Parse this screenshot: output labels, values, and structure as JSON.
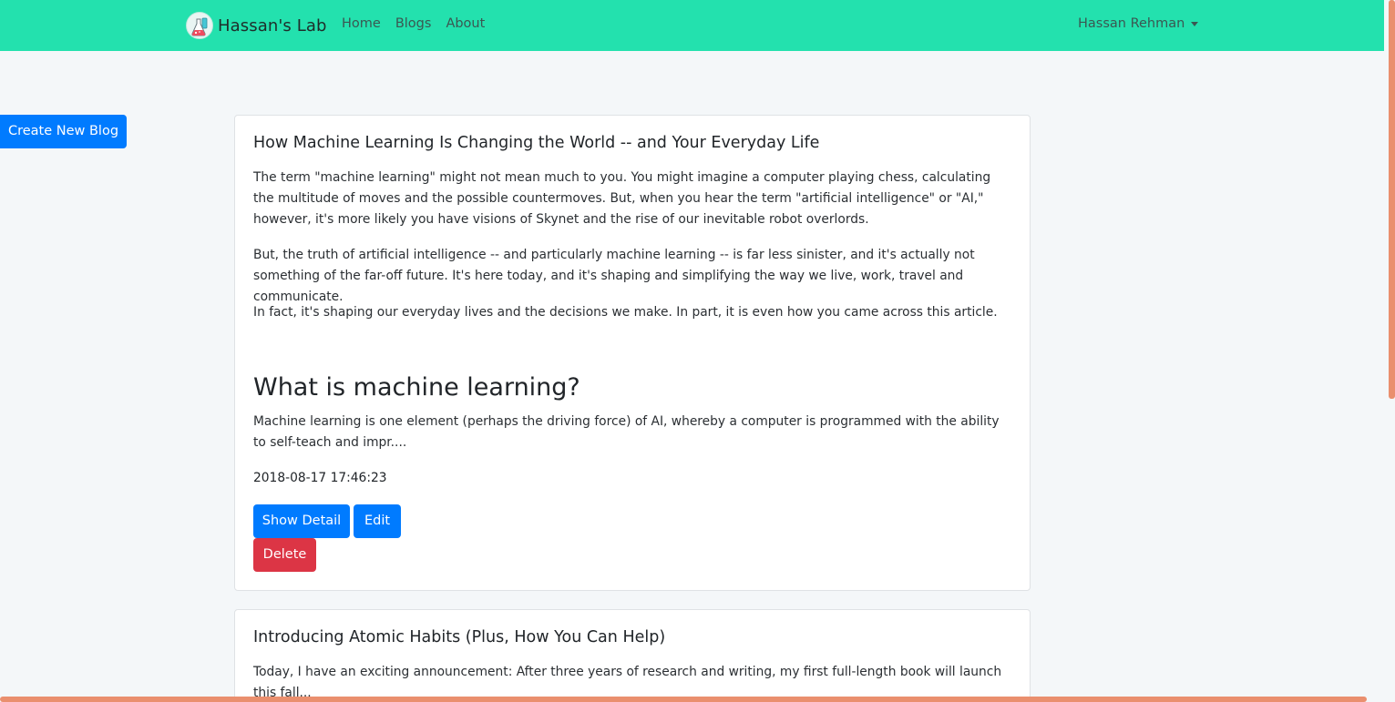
{
  "navbar": {
    "brand": "Hassan's Lab",
    "links": [
      "Home",
      "Blogs",
      "About"
    ],
    "user": "Hassan Rehman"
  },
  "actions": {
    "create_label": "Create New Blog"
  },
  "posts": [
    {
      "title": "How Machine Learning Is Changing the World -- and Your Everyday Life",
      "paragraphs": [
        "The term \"machine learning\" might not mean much to you. You might imagine a computer playing chess, calculating the multitude of moves and the possible countermoves. But, when you hear the term \"artificial intelligence\" or \"AI,\" however, it's more likely you have visions of Skynet and the rise of our inevitable robot overlords.",
        "But, the truth of artificial intelligence -- and particularly machine learning -- is far less sinister, and it's actually not something of the far-off future. It's here today, and it's shaping and simplifying the way we live, work, travel and communicate.",
        "In fact, it's shaping our everyday lives and the decisions we make. In part, it is even how you came across this article."
      ],
      "subheading": "What is machine learning?",
      "excerpt": "Machine learning is one element (perhaps the driving force) of AI, whereby a computer is programmed with the ability to self-teach and impr....",
      "date": "2018-08-17 17:46:23",
      "buttons": {
        "show": "Show Detail",
        "edit": "Edit",
        "delete": "Delete"
      }
    },
    {
      "title": "Introducing Atomic Habits (Plus, How You Can Help)",
      "paragraphs": [
        "Today, I have an exciting announcement: After three years of research and writing, my first full-length book will launch this fall..."
      ]
    }
  ],
  "colors": {
    "navbar": "#23e1ae",
    "primary": "#007bff",
    "danger": "#dc3545",
    "background": "#f4f7f9",
    "scrollbar": "#ea8f6e"
  }
}
